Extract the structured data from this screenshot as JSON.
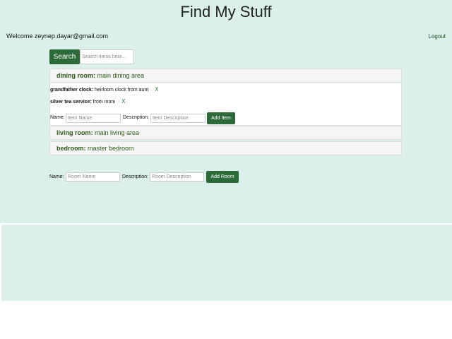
{
  "header": {
    "title": "Find My Stuff"
  },
  "user": {
    "welcome": "Welcome zeynep.dayar@gmail.com",
    "logout": "Logout"
  },
  "search": {
    "button": "Search",
    "placeholder": "Search items here..."
  },
  "rooms": [
    {
      "name": "dining room:",
      "description": "main dining area",
      "expanded": true,
      "items": [
        {
          "name": "grandfather clock:",
          "description": "heirloom clock from aunt",
          "delete": "X"
        },
        {
          "name": "silver tea service:",
          "description": "from mom",
          "delete": "X"
        }
      ],
      "item_form": {
        "name_label": "Name:",
        "name_placeholder": "Item Name",
        "desc_label": "Description:",
        "desc_placeholder": "Item Description",
        "button": "Add Item"
      }
    },
    {
      "name": "living room:",
      "description": "main living area",
      "expanded": false
    },
    {
      "name": "bedroom:",
      "description": "master bedroom",
      "expanded": false
    }
  ],
  "room_form": {
    "name_label": "Name:",
    "name_placeholder": "Room Name",
    "desc_label": "Description:",
    "desc_placeholder": "Room Description",
    "button": "Add Room"
  }
}
